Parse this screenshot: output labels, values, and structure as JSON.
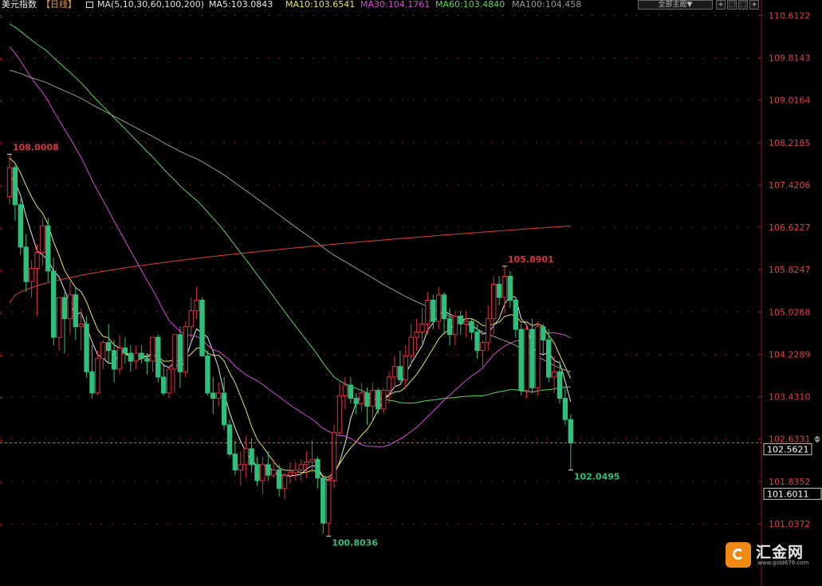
{
  "header": {
    "title": "美元指数",
    "period": "【日线】",
    "ma_label": "MA(5,10,30,60,100,200)",
    "ma_values": [
      {
        "text": "MA5:103.0843",
        "color": "#e8e8e8"
      },
      {
        "text": "MA10:103.6541",
        "color": "#e6e65a"
      },
      {
        "text": "MA30:104.1761",
        "color": "#d84ad8"
      },
      {
        "text": "MA60:103.4840",
        "color": "#5ad85a"
      },
      {
        "text": "MA100:104.458",
        "color": "#9a9a9a"
      }
    ],
    "theme_button": "全部主题▼",
    "win_buttons": [
      "+",
      "⬚",
      "⬚",
      "+"
    ]
  },
  "colors": {
    "up": "#e03040",
    "down": "#2ec07a",
    "ma200": "#e04030",
    "grid": "#8a1a1a",
    "axis_text": "#e04048",
    "current_line": "#d87a3a"
  },
  "watermark": {
    "name": "汇金网",
    "url": "www.gold678.com"
  },
  "chart_data": {
    "type": "candlestick",
    "title": "美元指数 日线",
    "y_axis_ticks": [
      110.6122,
      109.8143,
      109.0164,
      108.2185,
      107.4206,
      106.6227,
      105.8247,
      105.0268,
      104.2289,
      103.431,
      102.6331,
      101.8352,
      101.0372
    ],
    "ylim": [
      100.75,
      110.65
    ],
    "current_price": 102.5621,
    "last_close_label": 101.6011,
    "annotations": [
      {
        "label": "108.0008",
        "value": 108.0008,
        "kind": "high"
      },
      {
        "label": "105.8901",
        "value": 105.8901,
        "kind": "high"
      },
      {
        "label": "100.8036",
        "value": 100.8036,
        "kind": "low"
      },
      {
        "label": "102.0495",
        "value": 102.0495,
        "kind": "low"
      }
    ],
    "candles_ohlc": [
      [
        107.2,
        108.0,
        107.05,
        107.75
      ],
      [
        107.75,
        107.8,
        106.75,
        107.05
      ],
      [
        107.05,
        107.15,
        106.1,
        106.25
      ],
      [
        106.25,
        106.5,
        105.4,
        105.6
      ],
      [
        105.6,
        106.0,
        105.3,
        105.85
      ],
      [
        105.85,
        106.3,
        104.95,
        106.15
      ],
      [
        106.15,
        106.8,
        105.9,
        106.65
      ],
      [
        106.65,
        106.8,
        105.6,
        105.8
      ],
      [
        105.8,
        106.05,
        104.4,
        104.55
      ],
      [
        104.55,
        105.3,
        104.3,
        105.3
      ],
      [
        105.3,
        105.4,
        104.25,
        104.9
      ],
      [
        104.9,
        105.6,
        104.6,
        105.35
      ],
      [
        105.35,
        105.5,
        104.5,
        104.75
      ],
      [
        104.75,
        105.1,
        104.3,
        104.8
      ],
      [
        104.8,
        104.95,
        103.8,
        103.9
      ],
      [
        103.9,
        104.4,
        103.4,
        103.5
      ],
      [
        103.5,
        104.3,
        103.45,
        104.15
      ],
      [
        104.15,
        104.5,
        103.95,
        104.45
      ],
      [
        104.45,
        104.8,
        104.05,
        104.3
      ],
      [
        104.3,
        104.5,
        103.7,
        103.95
      ],
      [
        103.95,
        104.6,
        103.85,
        104.35
      ],
      [
        104.35,
        104.55,
        104.05,
        104.25
      ],
      [
        104.25,
        104.4,
        103.9,
        104.1
      ],
      [
        104.1,
        104.4,
        103.95,
        104.25
      ],
      [
        104.25,
        104.4,
        104.05,
        104.15
      ],
      [
        104.15,
        104.25,
        103.85,
        104.1
      ],
      [
        104.1,
        104.55,
        103.9,
        104.55
      ],
      [
        104.55,
        104.6,
        103.7,
        103.8
      ],
      [
        103.8,
        104.05,
        103.45,
        103.5
      ],
      [
        103.5,
        104.0,
        103.4,
        103.95
      ],
      [
        103.95,
        104.6,
        103.5,
        104.6
      ],
      [
        104.6,
        104.75,
        103.6,
        103.9
      ],
      [
        103.9,
        104.85,
        103.8,
        104.75
      ],
      [
        104.75,
        105.3,
        104.45,
        105.05
      ],
      [
        105.05,
        105.5,
        104.9,
        105.25
      ],
      [
        105.25,
        105.3,
        104.2,
        104.2
      ],
      [
        104.2,
        104.3,
        103.45,
        103.5
      ],
      [
        103.5,
        103.8,
        103.1,
        103.4
      ],
      [
        103.4,
        103.7,
        103.25,
        103.5
      ],
      [
        103.5,
        103.8,
        102.8,
        102.9
      ],
      [
        102.9,
        103.0,
        102.3,
        102.35
      ],
      [
        102.35,
        102.6,
        101.95,
        102.05
      ],
      [
        102.05,
        102.4,
        101.75,
        102.15
      ],
      [
        102.15,
        102.7,
        101.9,
        102.45
      ],
      [
        102.45,
        102.65,
        102.0,
        102.15
      ],
      [
        102.15,
        102.3,
        101.75,
        101.85
      ],
      [
        101.85,
        102.3,
        101.6,
        102.15
      ],
      [
        102.15,
        102.4,
        101.85,
        101.95
      ],
      [
        101.95,
        102.25,
        101.9,
        102.05
      ],
      [
        102.05,
        102.15,
        101.55,
        101.7
      ],
      [
        101.7,
        102.0,
        101.5,
        101.95
      ],
      [
        101.95,
        102.2,
        101.8,
        102.0
      ],
      [
        102.0,
        102.2,
        101.85,
        102.05
      ],
      [
        102.05,
        102.25,
        101.85,
        102.15
      ],
      [
        102.15,
        102.4,
        101.9,
        102.2
      ],
      [
        102.2,
        102.6,
        102.0,
        102.25
      ],
      [
        102.25,
        102.3,
        101.7,
        101.9
      ],
      [
        101.9,
        101.95,
        100.85,
        101.05
      ],
      [
        101.05,
        101.95,
        100.8,
        101.85
      ],
      [
        101.85,
        102.9,
        101.7,
        102.75
      ],
      [
        102.75,
        103.7,
        102.7,
        103.45
      ],
      [
        103.45,
        103.8,
        103.2,
        103.65
      ],
      [
        103.65,
        103.8,
        103.3,
        103.4
      ],
      [
        103.4,
        103.5,
        103.1,
        103.3
      ],
      [
        103.3,
        103.7,
        103.15,
        103.5
      ],
      [
        103.5,
        103.6,
        102.9,
        103.25
      ],
      [
        103.25,
        103.7,
        103.0,
        103.55
      ],
      [
        103.55,
        103.6,
        103.1,
        103.2
      ],
      [
        103.2,
        103.6,
        103.1,
        103.55
      ],
      [
        103.55,
        103.9,
        103.3,
        103.8
      ],
      [
        103.8,
        104.2,
        103.6,
        104.0
      ],
      [
        104.0,
        104.3,
        103.7,
        103.75
      ],
      [
        103.75,
        104.4,
        103.6,
        104.2
      ],
      [
        104.2,
        104.8,
        104.0,
        104.55
      ],
      [
        104.55,
        104.9,
        104.3,
        104.65
      ],
      [
        104.65,
        105.1,
        104.4,
        104.8
      ],
      [
        104.8,
        105.4,
        104.6,
        105.25
      ],
      [
        105.25,
        105.35,
        104.7,
        104.85
      ],
      [
        104.85,
        105.5,
        104.7,
        105.35
      ],
      [
        105.35,
        105.4,
        104.6,
        104.9
      ],
      [
        104.9,
        105.1,
        104.4,
        104.6
      ],
      [
        104.6,
        105.05,
        104.4,
        104.95
      ],
      [
        104.95,
        105.05,
        104.6,
        104.8
      ],
      [
        104.8,
        105.05,
        104.55,
        104.85
      ],
      [
        104.85,
        104.9,
        104.5,
        104.65
      ],
      [
        104.65,
        104.8,
        104.15,
        104.3
      ],
      [
        104.3,
        104.5,
        104.0,
        104.45
      ],
      [
        104.45,
        105.15,
        104.3,
        104.9
      ],
      [
        104.9,
        105.7,
        104.6,
        105.55
      ],
      [
        105.55,
        105.7,
        105.15,
        105.3
      ],
      [
        105.3,
        105.89,
        105.0,
        105.7
      ],
      [
        105.7,
        105.8,
        105.1,
        105.25
      ],
      [
        105.25,
        105.3,
        104.55,
        104.7
      ],
      [
        104.7,
        104.8,
        103.45,
        103.55
      ],
      [
        103.55,
        104.8,
        103.4,
        104.7
      ],
      [
        104.7,
        104.9,
        103.5,
        103.6
      ],
      [
        103.6,
        104.85,
        103.45,
        104.75
      ],
      [
        104.75,
        104.8,
        104.2,
        104.5
      ],
      [
        104.5,
        104.7,
        103.7,
        103.8
      ],
      [
        103.8,
        104.2,
        103.5,
        103.9
      ],
      [
        103.9,
        104.1,
        103.3,
        103.4
      ],
      [
        103.4,
        103.6,
        102.9,
        103.0
      ],
      [
        103.0,
        103.1,
        102.05,
        102.56
      ]
    ]
  }
}
